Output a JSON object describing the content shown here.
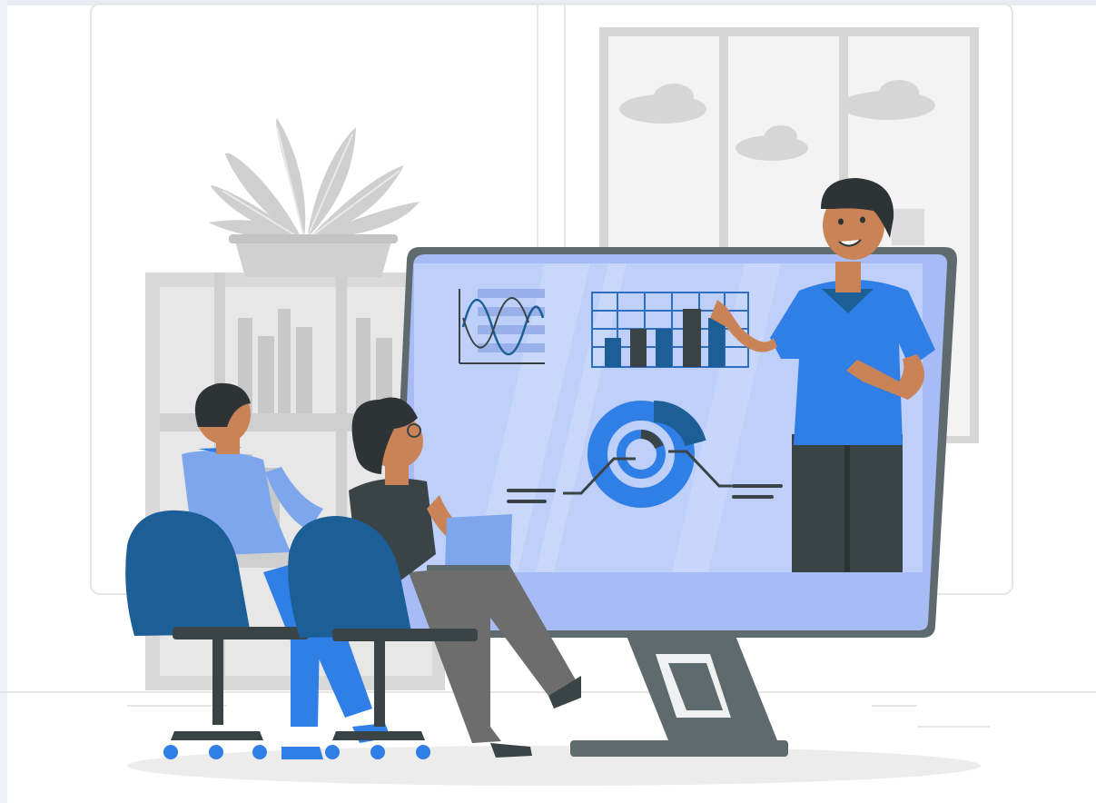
{
  "illustration": {
    "subject": "online-presentation",
    "colors": {
      "primary_blue": "#2f7fe6",
      "dark_blue": "#1c5f97",
      "light_blue_screen": "#b4c8f7",
      "monitor_frame": "#a7bcf5",
      "grey_furniture": "#d9d9d9",
      "dark_grey": "#3a4446",
      "skin": "#c98357",
      "hair": "#2e3436",
      "floor_shadow": "#ececec"
    },
    "icons": [
      "plant-icon",
      "window-icon",
      "monitor-icon",
      "office-chair-icon",
      "laptop-icon",
      "line-chart-icon",
      "bar-chart-icon",
      "donut-chart-icon"
    ]
  }
}
